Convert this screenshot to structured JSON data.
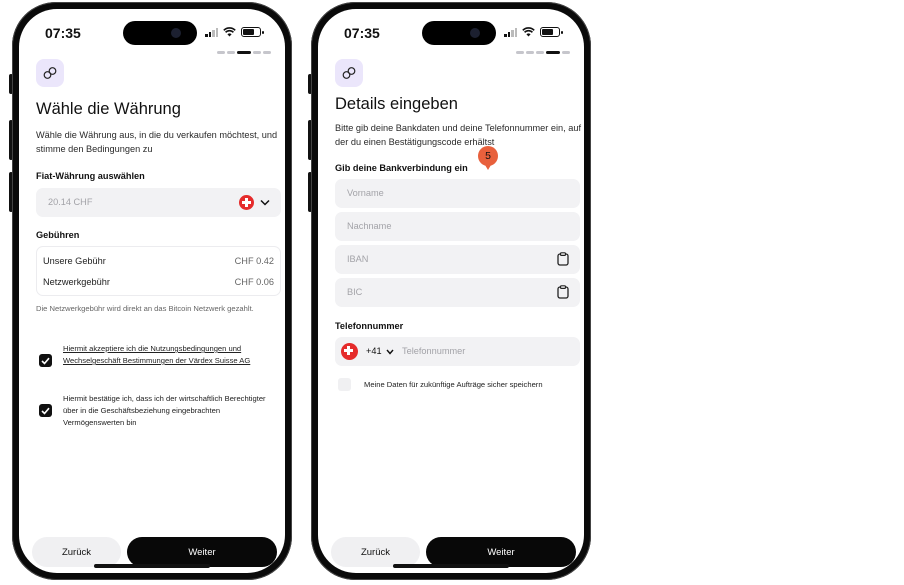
{
  "status_bar": {
    "time": "07:35"
  },
  "screen1": {
    "title": "Wähle die Währung",
    "description": "Wähle die Währung aus, in die du verkaufen möchtest, und stimme den Bedingungen zu",
    "fiat_label": "Fiat-Währung auswählen",
    "fiat_value": "20.14 CHF",
    "fees_label": "Gebühren",
    "fees": [
      {
        "name": "Unsere Gebühr",
        "value": "CHF 0.42"
      },
      {
        "name": "Netzwerkgebühr",
        "value": "CHF 0.06"
      }
    ],
    "fee_note": "Die Netzwerkgebühr wird direkt an das Bitcoin Netzwerk gezahlt.",
    "checkbox_terms": "Hiermit akzeptiere ich die Nutzungsbedingungen und Wechselgeschäft Bestimmungen der Värdex Suisse AG",
    "checkbox_beneficial": "Hiermit bestätige ich, dass ich der wirtschaftlich Berechtigter über in die Geschäftsbeziehung eingebrachten Vermögenswerten bin",
    "back_label": "Zurück",
    "next_label": "Weiter"
  },
  "screen2": {
    "title": "Details eingeben",
    "description": "Bitte gib deine Bankdaten und deine Telefonnummer ein, auf der du einen Bestätigungscode erhältst",
    "bank_label": "Gib deine Bankverbindung ein",
    "step_badge": "5",
    "placeholders": {
      "first_name": "Vorname",
      "last_name": "Nachname",
      "iban": "IBAN",
      "bic": "BIC",
      "phone": "Telefonnummer"
    },
    "phone_label": "Telefonnummer",
    "country_code": "+41",
    "save_label": "Meine Daten für zukünftige Aufträge sicher speichern",
    "back_label": "Zurück",
    "next_label": "Weiter"
  },
  "icons": {
    "logo": "link-logo-icon",
    "flag": "swiss-flag-icon",
    "chevron": "chevron-down-icon",
    "clipboard": "clipboard-icon",
    "check": "checkmark-icon"
  },
  "colors": {
    "accent_logo_bg": "#ebe6fb",
    "badge": "#e8603c",
    "primary_button": "#080808",
    "swiss_red": "#e52b2b"
  }
}
